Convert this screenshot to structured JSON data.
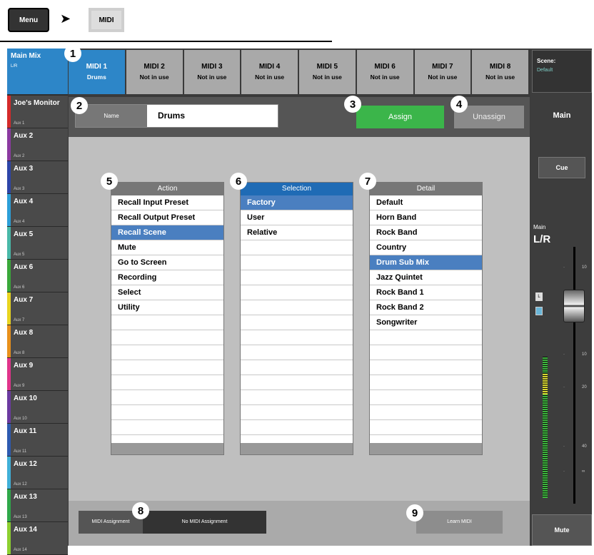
{
  "breadcrumb": {
    "menu_label": "Menu",
    "arrow": "➤",
    "midi_label": "MIDI"
  },
  "main_mix": {
    "title": "Main Mix",
    "sub": "L/R"
  },
  "aux_channels": [
    {
      "name": "Joe's Monitor",
      "sub": "Aux 1",
      "color": "#d42a2a"
    },
    {
      "name": "Aux 2",
      "sub": "Aux 2",
      "color": "#8b3aa0"
    },
    {
      "name": "Aux 3",
      "sub": "Aux 3",
      "color": "#2d45a8"
    },
    {
      "name": "Aux 4",
      "sub": "Aux 4",
      "color": "#2c9fd8"
    },
    {
      "name": "Aux 5",
      "sub": "Aux 5",
      "color": "#49b8a8"
    },
    {
      "name": "Aux 6",
      "sub": "Aux 6",
      "color": "#3aa83a"
    },
    {
      "name": "Aux 7",
      "sub": "Aux 7",
      "color": "#e8d420"
    },
    {
      "name": "Aux 8",
      "sub": "Aux 8",
      "color": "#e8901c"
    },
    {
      "name": "Aux 9",
      "sub": "Aux 9",
      "color": "#e0348a"
    },
    {
      "name": "Aux 10",
      "sub": "Aux 10",
      "color": "#6b3aa0"
    },
    {
      "name": "Aux 11",
      "sub": "Aux 11",
      "color": "#2d5ab0"
    },
    {
      "name": "Aux 12",
      "sub": "Aux 12",
      "color": "#40b0d8"
    },
    {
      "name": "Aux 13",
      "sub": "Aux 13",
      "color": "#2fa84a"
    },
    {
      "name": "Aux 14",
      "sub": "Aux 14",
      "color": "#8ccf30"
    }
  ],
  "tabs": [
    {
      "name": "MIDI 1",
      "status": "Drums"
    },
    {
      "name": "MIDI 2",
      "status": "Not in use"
    },
    {
      "name": "MIDI 3",
      "status": "Not in use"
    },
    {
      "name": "MIDI 4",
      "status": "Not in use"
    },
    {
      "name": "MIDI 5",
      "status": "Not in use"
    },
    {
      "name": "MIDI 6",
      "status": "Not in use"
    },
    {
      "name": "MIDI 7",
      "status": "Not in use"
    },
    {
      "name": "MIDI 8",
      "status": "Not in use"
    }
  ],
  "scene": {
    "label": "Scene:",
    "value": "Default"
  },
  "name_field": {
    "label": "Name",
    "value": "Drums"
  },
  "assign_label": "Assign",
  "unassign_label": "Unassign",
  "right": {
    "main_label": "Main",
    "cue_label": "Cue",
    "main_lr_label": "Main",
    "main_lr_value": "L/R",
    "mute_label": "Mute",
    "meter_l": "L",
    "scale": [
      "10",
      "0",
      "5",
      "10",
      "20",
      "40",
      "∞"
    ]
  },
  "action_list": {
    "header": "Action",
    "items": [
      "Recall Input Preset",
      "Recall Output Preset",
      "Recall Scene",
      "Mute",
      "Go to Screen",
      "Recording",
      "Select",
      "Utility"
    ],
    "selected": 2
  },
  "selection_list": {
    "header": "Selection",
    "items": [
      "Factory",
      "User",
      "Relative"
    ],
    "selected": 0
  },
  "detail_list": {
    "header": "Detail",
    "items": [
      "Default",
      "Horn Band",
      "Rock Band",
      "Country",
      "Drum Sub Mix",
      "Jazz Quintet",
      "Rock Band 1",
      "Rock Band 2",
      "Songwriter"
    ],
    "selected": 4
  },
  "midi_assignment": {
    "label": "MIDI Assignment",
    "value": "No MIDI Assignment"
  },
  "learn_midi_label": "Learn MIDI",
  "callouts": [
    "1",
    "2",
    "3",
    "4",
    "5",
    "6",
    "7",
    "8",
    "9"
  ],
  "colors": {
    "accent_blue": "#2d86c8",
    "assign_green": "#3bb54a",
    "selection_blue": "#4a7fc0"
  }
}
